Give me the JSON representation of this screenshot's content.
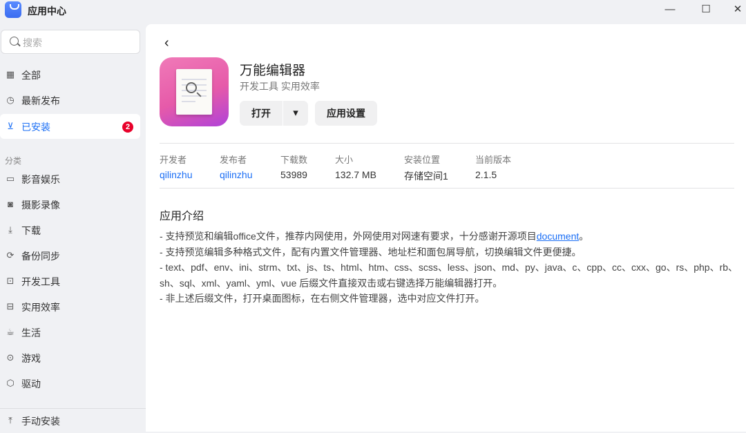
{
  "window": {
    "title": "应用中心",
    "minimize": "—",
    "maximize": "☐",
    "close": "✕"
  },
  "sidebar": {
    "search_placeholder": "搜索",
    "items": [
      {
        "label": "全部",
        "icon": "grid-icon"
      },
      {
        "label": "最新发布",
        "icon": "clock-icon"
      },
      {
        "label": "已安装",
        "icon": "installed-icon",
        "badge": "2"
      }
    ],
    "section_label": "分类",
    "categories": [
      {
        "label": "影音娱乐",
        "icon": "video-icon"
      },
      {
        "label": "摄影录像",
        "icon": "camera-icon"
      },
      {
        "label": "下载",
        "icon": "download-icon"
      },
      {
        "label": "备份同步",
        "icon": "sync-icon"
      },
      {
        "label": "开发工具",
        "icon": "code-icon"
      },
      {
        "label": "实用效率",
        "icon": "briefcase-icon"
      },
      {
        "label": "生活",
        "icon": "cup-icon"
      },
      {
        "label": "游戏",
        "icon": "gamepad-icon"
      },
      {
        "label": "驱动",
        "icon": "cube-icon"
      }
    ],
    "manual_install": "手动安装"
  },
  "app": {
    "back": "‹",
    "name": "万能编辑器",
    "categories": "开发工具 实用效率",
    "open_label": "打开",
    "dropdown": "▾",
    "settings_label": "应用设置",
    "meta": [
      {
        "key": "开发者",
        "value": "qilinzhu"
      },
      {
        "key": "发布者",
        "value": "qilinzhu"
      },
      {
        "key": "下载数",
        "value": "53989"
      },
      {
        "key": "大小",
        "value": "132.7 MB"
      },
      {
        "key": "安装位置",
        "value": "存储空间1"
      },
      {
        "key": "当前版本",
        "value": "2.1.5"
      }
    ],
    "intro_title": "应用介绍",
    "intro": {
      "line1_pre": "- 支持预览和编辑office文件，推荐内网使用，外网使用对网速有要求，十分感谢开源项目",
      "line1_link": "document",
      "line1_post": "。",
      "line2": "- 支持预览编辑多种格式文件，配有内置文件管理器、地址栏和面包屑导航，切换编辑文件更便捷。",
      "line3": "- text、pdf、env、ini、strm、txt、js、ts、html、htm、css、scss、less、json、md、py、java、c、cpp、cc、cxx、go、rs、php、rb、sh、sql、xml、yaml、yml、vue 后缀文件直接双击或右键选择万能编辑器打开。",
      "line4": "- 非上述后缀文件，打开桌面图标，在右侧文件管理器，选中对应文件打开。"
    }
  }
}
